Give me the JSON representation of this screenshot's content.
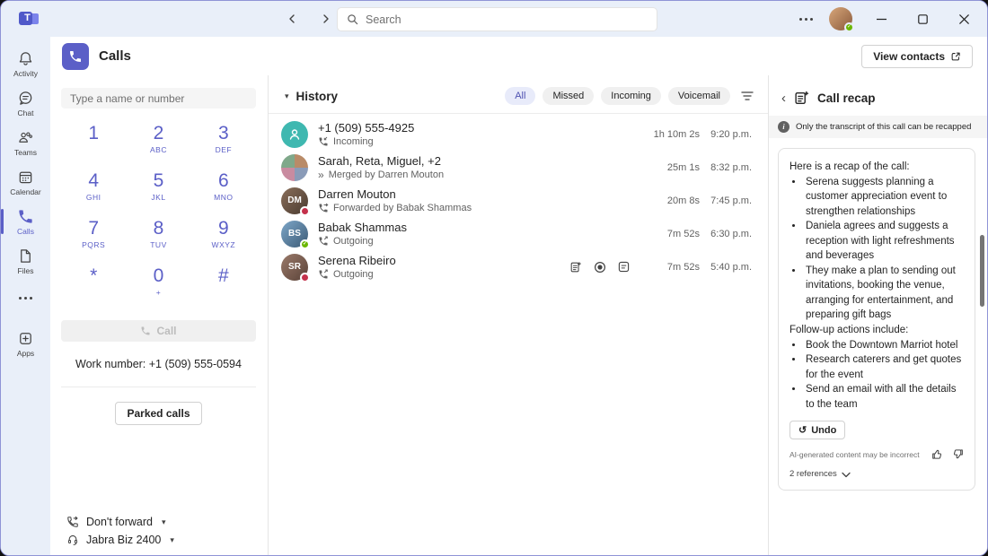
{
  "titlebar": {
    "search_placeholder": "Search"
  },
  "rail": {
    "items": [
      {
        "label": "Activity"
      },
      {
        "label": "Chat"
      },
      {
        "label": "Teams"
      },
      {
        "label": "Calendar"
      },
      {
        "label": "Calls"
      },
      {
        "label": "Files"
      },
      {
        "label": "Apps"
      }
    ]
  },
  "header": {
    "title": "Calls",
    "view_contacts_label": "View contacts"
  },
  "dialpad": {
    "input_placeholder": "Type a name or number",
    "keys": [
      {
        "digit": "1",
        "letters": ""
      },
      {
        "digit": "2",
        "letters": "ABC"
      },
      {
        "digit": "3",
        "letters": "DEF"
      },
      {
        "digit": "4",
        "letters": "GHI"
      },
      {
        "digit": "5",
        "letters": "JKL"
      },
      {
        "digit": "6",
        "letters": "MNO"
      },
      {
        "digit": "7",
        "letters": "PQRS"
      },
      {
        "digit": "8",
        "letters": "TUV"
      },
      {
        "digit": "9",
        "letters": "WXYZ"
      },
      {
        "digit": "*",
        "letters": ""
      },
      {
        "digit": "0",
        "letters": "+"
      },
      {
        "digit": "#",
        "letters": ""
      }
    ],
    "call_button_label": "Call",
    "work_number": "Work number: +1 (509) 555-0594",
    "parked_calls_label": "Parked calls",
    "forward_label": "Don't forward",
    "audio_device_label": "Jabra Biz 2400",
    "caret": "▾"
  },
  "history": {
    "title": "History",
    "caret": "▾",
    "filters": [
      {
        "label": "All"
      },
      {
        "label": "Missed"
      },
      {
        "label": "Incoming"
      },
      {
        "label": "Voicemail"
      }
    ],
    "rows": [
      {
        "name": "+1 (509) 555-4925",
        "detail": "Incoming",
        "duration": "1h 10m 2s",
        "time": "9:20 p.m.",
        "initials": ""
      },
      {
        "name": "Sarah, Reta, Miguel, +2",
        "detail": "Merged by Darren Mouton",
        "duration": "25m 1s",
        "time": "8:32 p.m.",
        "initials": ""
      },
      {
        "name": "Darren Mouton",
        "detail": "Forwarded by Babak Shammas",
        "duration": "20m 8s",
        "time": "7:45 p.m.",
        "initials": "DM"
      },
      {
        "name": "Babak Shammas",
        "detail": "Outgoing",
        "duration": "7m 52s",
        "time": "6:30 p.m.",
        "initials": "BS"
      },
      {
        "name": "Serena Ribeiro",
        "detail": "Outgoing",
        "duration": "7m 52s",
        "time": "5:40 p.m.",
        "initials": "SR"
      }
    ],
    "merge_glyph": "»"
  },
  "recap": {
    "back_glyph": "‹",
    "title": "Call recap",
    "notice": "Only the transcript of this call can be recapped",
    "intro": "Here is a recap of the call:",
    "bullets1": [
      "Serena suggests planning a customer appreciation event to strengthen relationships",
      "Daniela agrees and suggests a reception with light refreshments and beverages",
      "They make a plan to sending out invitations, booking the venue, arranging for entertainment, and preparing gift bags"
    ],
    "followup_heading": "Follow-up actions include:",
    "bullets2": [
      "Book the Downtown Marriot hotel",
      "Research caterers and get quotes for the event",
      "Send an email with all the details to the team"
    ],
    "undo_glyph": "↺",
    "undo_label": "Undo",
    "ai_disclaimer": "AI-generated content may be incorrect",
    "references_label": "2 references"
  },
  "colors": {
    "accent": "#5b5fc7",
    "busy": "#c4314b",
    "available": "#6bb700"
  }
}
